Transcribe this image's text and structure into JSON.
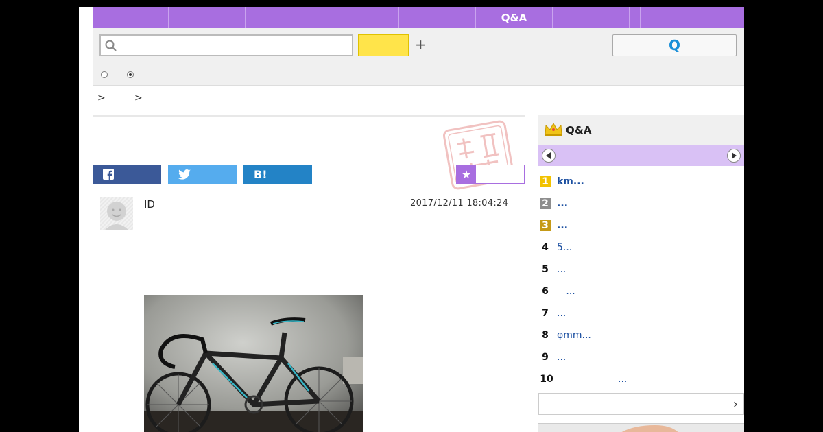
{
  "nav": {
    "items": [
      "",
      "",
      "",
      "",
      "",
      "Q&A",
      "",
      "",
      ""
    ]
  },
  "search": {
    "placeholder": "",
    "value": "",
    "yellow_label": "",
    "plus": "+",
    "qa_button": "Q"
  },
  "breadcrumb": {
    "sep1": ">",
    "sep2": ">"
  },
  "share": {
    "facebook": "f",
    "twitter": "",
    "hatena": "B!"
  },
  "favorite": {
    "star": "★",
    "label": ""
  },
  "question": {
    "user_id": "ID",
    "posted": "2017/12/11  18:04:24"
  },
  "ranking": {
    "title": "Q&A",
    "items": [
      {
        "rank": "1",
        "text": "km..."
      },
      {
        "rank": "2",
        "text": "..."
      },
      {
        "rank": "3",
        "text": "..."
      },
      {
        "rank": "4",
        "text": "5..."
      },
      {
        "rank": "5",
        "text": "..."
      },
      {
        "rank": "6",
        "text": "   ..."
      },
      {
        "rank": "7",
        "text": "..."
      },
      {
        "rank": "8",
        "text": "φmm..."
      },
      {
        "rank": "9",
        "text": "..."
      },
      {
        "rank": "10",
        "text": "                    ..."
      }
    ],
    "more_chevron": "›"
  },
  "colors": {
    "nav": "#a86ee0",
    "tab": "#d9c1f5",
    "facebook": "#3b5998",
    "twitter": "#55acee",
    "hatena": "#2383c6",
    "link": "#1a4ea0"
  }
}
